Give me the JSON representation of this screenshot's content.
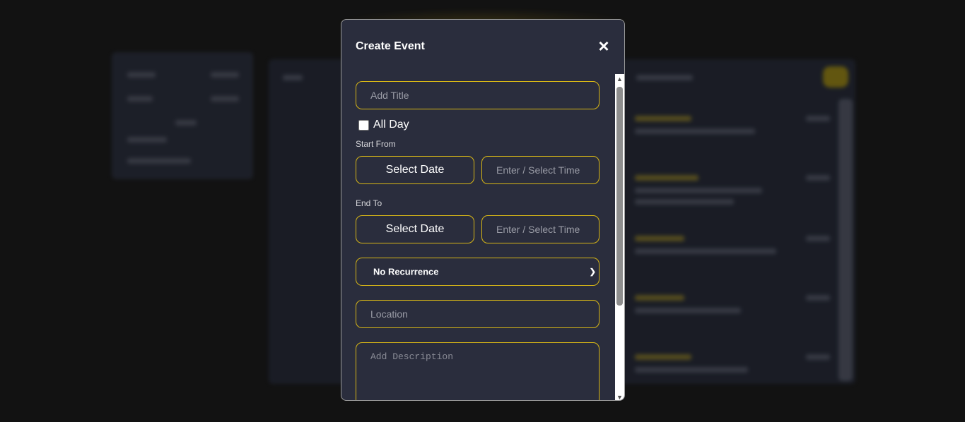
{
  "modal": {
    "title": "Create Event",
    "close_icon": "close-icon",
    "title_placeholder": "Add Title",
    "all_day_label": "All Day",
    "start_label": "Start From",
    "end_label": "End To",
    "select_date_label": "Select Date",
    "time_placeholder": "Enter / Select Time",
    "recurrence_value": "No Recurrence",
    "location_placeholder": "Location",
    "description_placeholder": "Add Description"
  },
  "colors": {
    "accent": "#d8b716",
    "modal_bg": "#2a2d3d",
    "backdrop": "#121212"
  }
}
